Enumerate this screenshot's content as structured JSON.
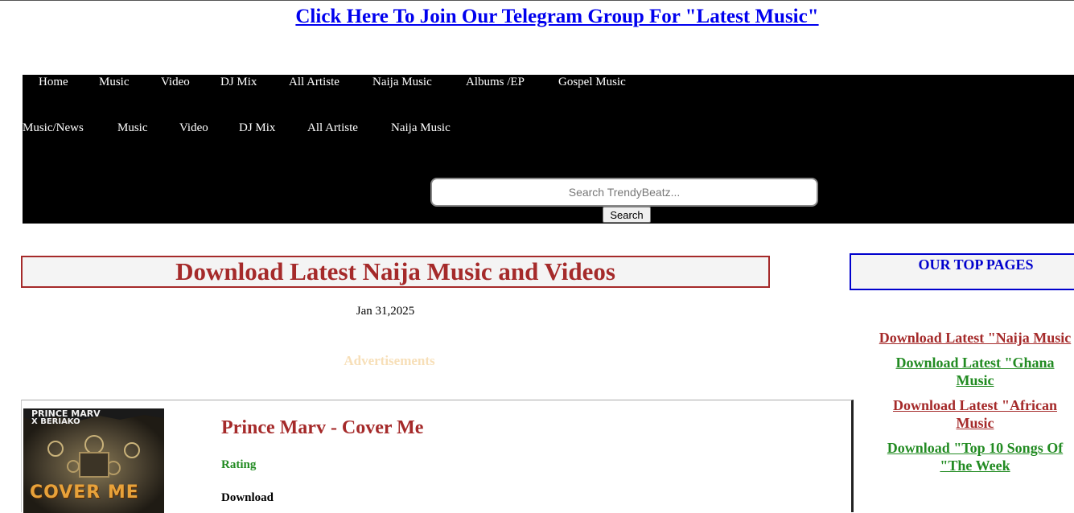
{
  "header": {
    "telegram_link": "Click Here To Join Our Telegram Group For \"Latest Music\""
  },
  "nav": {
    "row1": [
      "Home",
      "Music",
      "Video",
      "DJ Mix",
      "All Artiste",
      "Naija Music",
      "Albums /EP",
      "Gospel Music"
    ],
    "row2": [
      "Music/News",
      "Music",
      "Video",
      "DJ Mix",
      "All Artiste",
      "Naija Music"
    ]
  },
  "search": {
    "placeholder": "Search TrendyBeatz...",
    "button_label": "Search"
  },
  "main": {
    "heading": "Download Latest Naija Music and Videos",
    "date": "Jan 31,2025",
    "ads_label": "Advertisements",
    "post": {
      "thumb_caption_top": "PRINCE MARV",
      "thumb_caption_sub": "X BERIAKO",
      "thumb_caption_main": "COVER ME",
      "title": "Prince Marv - Cover Me",
      "rating_label": "Rating",
      "download_label": "Download"
    }
  },
  "sidebar": {
    "title": "OUR TOP PAGES",
    "links": [
      {
        "label": "Download Latest \"Naija Music",
        "color": "#a52a2a"
      },
      {
        "label": "Download Latest \"Ghana Music",
        "color": "#228b22"
      },
      {
        "label": "Download Latest \"African Music",
        "color": "#a52a2a"
      },
      {
        "label": "Download \"Top 10 Songs Of \"The Week",
        "color": "#228b22"
      }
    ]
  },
  "colors": {
    "heading": "#a52a2a",
    "rating": "#228b22",
    "sidebar_border": "#0000cd",
    "link": "#0000ee",
    "nav_bg": "#000000"
  }
}
